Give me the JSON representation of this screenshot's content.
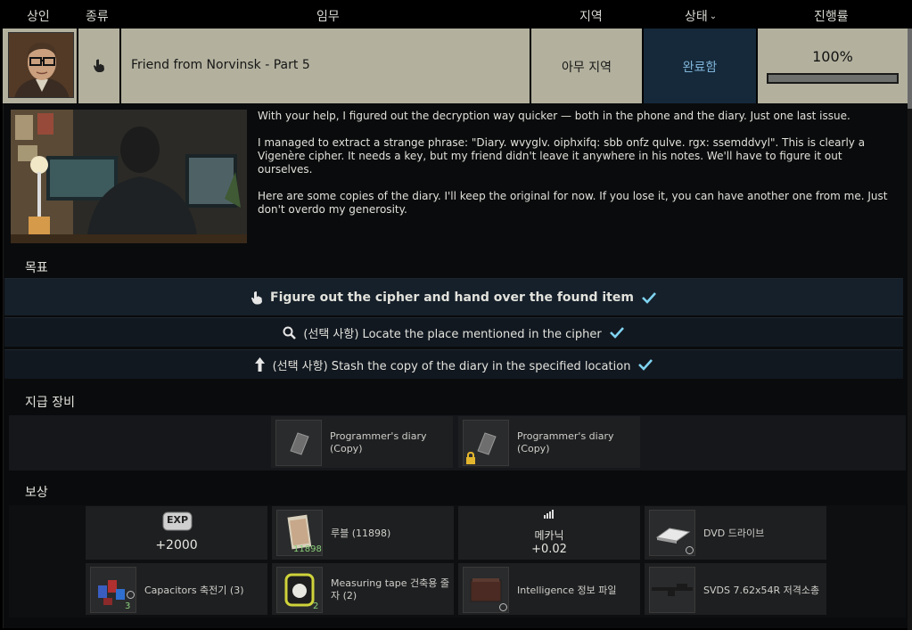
{
  "header": {
    "trader": "상인",
    "type": "종류",
    "task": "임무",
    "location": "지역",
    "status": "상태",
    "progress": "진행률"
  },
  "quest": {
    "name": "Friend from Norvinsk - Part 5",
    "location": "아무 지역",
    "status": "완료함",
    "progress_text": "100%",
    "progress_value": 1.0,
    "type_icon": "hand-pointer-icon"
  },
  "description": [
    "With your help, I figured out the decryption way quicker — both in the phone and the diary. Just one last issue.",
    "I managed to extract a strange phrase: \"Diary. wvyglv. oiphxifq: sbb onfz qulve. rgx: ssemddvyl\". This is clearly a Vigenère cipher. It needs a key, but my friend didn't leave it anywhere in his notes. We'll have to figure it out ourselves.",
    "Here are some copies of the diary. I'll keep the original for now. If you lose it, you can have another one from me. Just don't overdo my generosity."
  ],
  "objectives_title": "목표",
  "objectives": [
    {
      "text": "Figure out the cipher and hand over the found item",
      "icon": "hand-pointer-icon"
    },
    {
      "text": "(선택 사항) Locate the place mentioned in the cipher",
      "icon": "magnifier-icon"
    },
    {
      "text": "(선택 사항) Stash the copy of the diary in the specified location",
      "icon": "stash-arrow-icon"
    }
  ],
  "given_title": "지급 장비",
  "given_items": [
    {
      "label": "Programmer's diary (Copy)"
    },
    {
      "label": "Programmer's diary (Copy)"
    }
  ],
  "rewards_title": "보상",
  "rewards": {
    "exp_badge": "EXP",
    "exp_value": "+2000",
    "roubles_label": "루블 (11898)",
    "roubles_count": "11898",
    "skill_label": "메카닉",
    "skill_value": "+0.02",
    "dvd_label": "DVD 드라이브",
    "capacitors_label": "Capacitors 축전기 (3)",
    "capacitors_count": "3",
    "tape_label": "Measuring tape 건축용 줄자 (2)",
    "tape_count": "2",
    "intel_label": "Intelligence 정보 파일",
    "svds_label": "SVDS 7.62x54R 저격소총"
  },
  "colors": {
    "row_bg": "#b3b19e",
    "status_bg": "#15293a",
    "status_text": "#7fb4d8",
    "check": "#7fd3f0",
    "count_green": "#8bd07a"
  }
}
